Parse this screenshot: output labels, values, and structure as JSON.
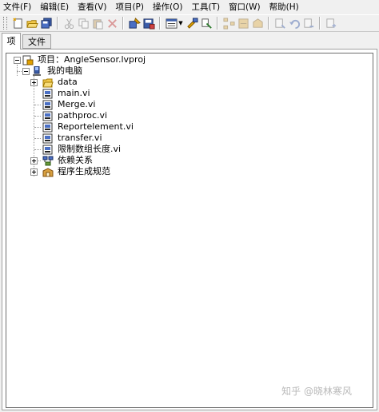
{
  "menubar": {
    "items": [
      {
        "label": "文件(F)"
      },
      {
        "label": "编辑(E)"
      },
      {
        "label": "查看(V)"
      },
      {
        "label": "项目(P)"
      },
      {
        "label": "操作(O)"
      },
      {
        "label": "工具(T)"
      },
      {
        "label": "窗口(W)"
      },
      {
        "label": "帮助(H)"
      }
    ]
  },
  "toolbar": {
    "buttons": [
      {
        "icon": "new-vi-icon"
      },
      {
        "icon": "open-icon"
      },
      {
        "icon": "save-all-icon"
      },
      {
        "icon": "cut-icon",
        "disabled": true
      },
      {
        "icon": "copy-icon",
        "disabled": true
      },
      {
        "icon": "paste-icon",
        "disabled": true
      },
      {
        "icon": "delete-icon",
        "disabled": true
      },
      {
        "icon": "build-icon"
      },
      {
        "icon": "save-project-icon"
      },
      {
        "icon": "view-icon"
      },
      {
        "icon": "resolve-icon"
      },
      {
        "icon": "filter-icon"
      },
      {
        "icon": "hierarchy-icon",
        "disabled": true
      },
      {
        "icon": "dependencies-icon",
        "disabled": true
      },
      {
        "icon": "package-icon",
        "disabled": true
      },
      {
        "icon": "add-item-icon",
        "disabled": true
      },
      {
        "icon": "undo-icon",
        "disabled": true
      },
      {
        "icon": "redo-icon",
        "disabled": true
      },
      {
        "icon": "properties-icon",
        "disabled": true
      }
    ]
  },
  "tabs": [
    {
      "label": "项",
      "active": true
    },
    {
      "label": "文件",
      "active": false
    }
  ],
  "tree": {
    "project": {
      "label": "项目：AngleSensor.lvproj"
    },
    "computer": {
      "label": "我的电脑"
    },
    "items": [
      {
        "label": "data",
        "type": "folder"
      },
      {
        "label": "main.vi",
        "type": "vi"
      },
      {
        "label": "Merge.vi",
        "type": "vi"
      },
      {
        "label": "pathproc.vi",
        "type": "vi"
      },
      {
        "label": "Reportelement.vi",
        "type": "vi"
      },
      {
        "label": "transfer.vi",
        "type": "vi"
      },
      {
        "label": "限制数组长度.vi",
        "type": "vi"
      },
      {
        "label": "依赖关系",
        "type": "dependencies"
      },
      {
        "label": "程序生成规范",
        "type": "build"
      }
    ]
  },
  "watermark": {
    "text": "知乎 @晓林寒风"
  },
  "colors": {
    "window_bg": "#f0f0f0",
    "tree_bg": "#ffffff",
    "border": "#a0a0a0"
  }
}
